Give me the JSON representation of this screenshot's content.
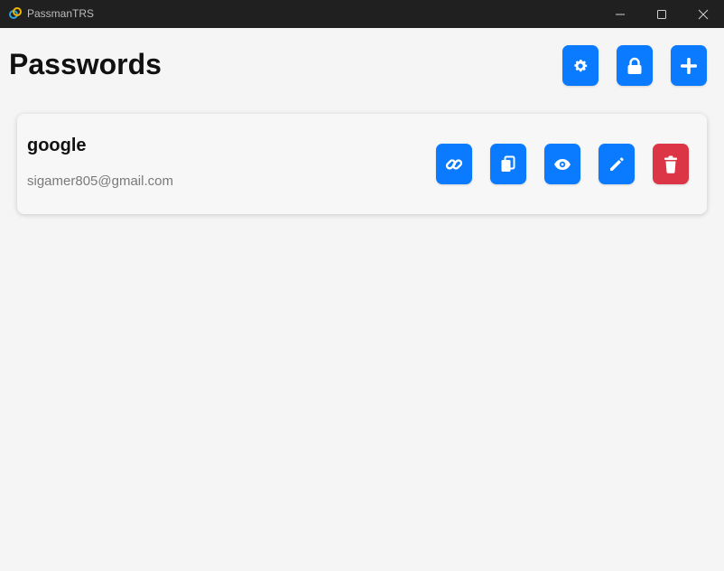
{
  "window": {
    "title": "PassmanTRS",
    "controls": [
      "minimize-icon",
      "maximize-icon",
      "close-icon"
    ]
  },
  "header": {
    "title": "Passwords",
    "buttons": [
      {
        "name": "settings-button",
        "icon": "gear-icon"
      },
      {
        "name": "lock-button",
        "icon": "lock-icon"
      },
      {
        "name": "add-button",
        "icon": "plus-icon"
      }
    ]
  },
  "entries": [
    {
      "name": "google",
      "username": "sigamer805@gmail.com",
      "actions": [
        "link-icon",
        "copy-icon",
        "eye-icon",
        "pencil-icon",
        "trash-icon"
      ]
    }
  ],
  "colors": {
    "primary": "#0a7bff",
    "danger": "#dc3545",
    "background": "#f5f5f5",
    "titlebar": "#202020"
  }
}
